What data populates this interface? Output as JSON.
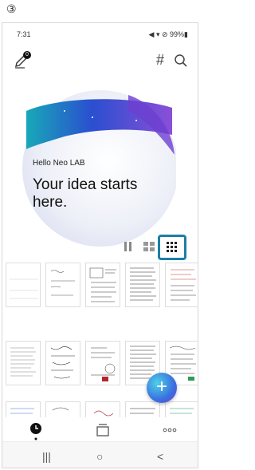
{
  "step_label": "③",
  "status": {
    "time": "7:31",
    "right": "◀ ▾ ⊘ 99%▮"
  },
  "topbar": {
    "hash_icon": "#",
    "badge": "0"
  },
  "hero": {
    "greeting": "Hello Neo LAB",
    "headline": "Your idea starts here."
  },
  "colors": {
    "accent": "#1b7fa6",
    "fab": "#3a6fe0"
  },
  "view_modes": [
    "list-view-icon",
    "medium-grid-icon",
    "small-grid-icon"
  ],
  "fab": {
    "label": "+"
  },
  "sysnav": {
    "recent": "|||",
    "home": "○",
    "back": "<"
  }
}
